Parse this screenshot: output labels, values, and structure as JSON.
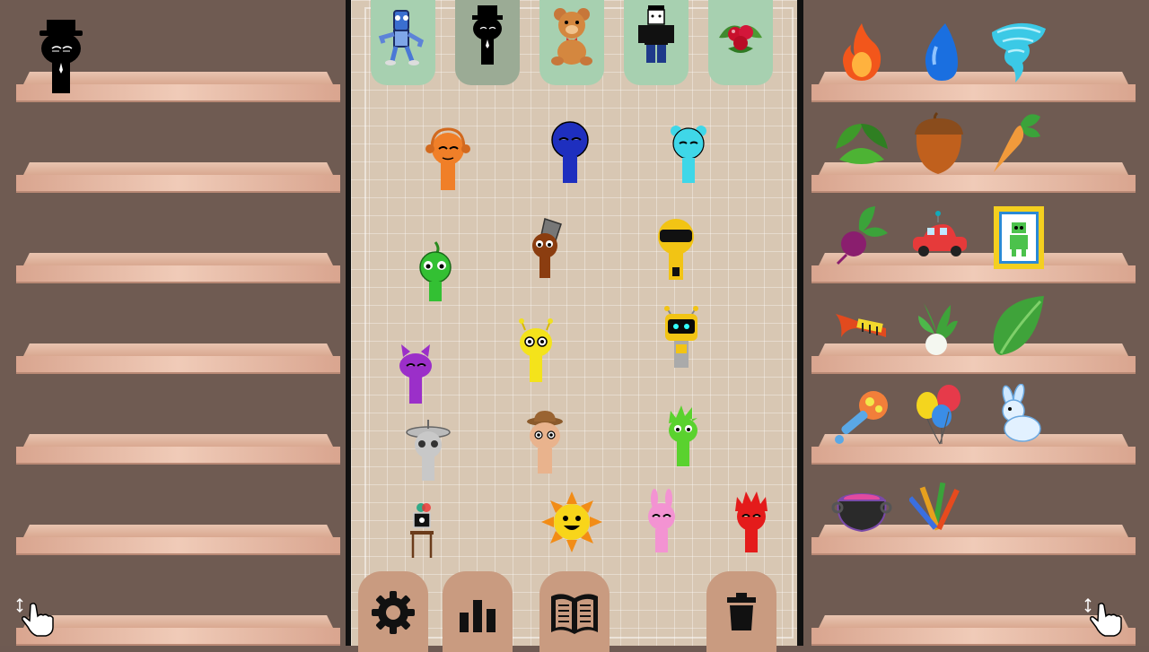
{
  "left_panel": {
    "shelves": 7,
    "placed_items": [
      {
        "id": "black-top-hat",
        "icon": "black-top-hat-character-icon"
      }
    ],
    "scroll_hint": "hand-scroll-icon"
  },
  "top_slots": [
    {
      "icon": "blue-robot-character-icon",
      "state": "available"
    },
    {
      "icon": "black-top-hat-character-icon",
      "state": "used"
    },
    {
      "icon": "teddy-bear-icon",
      "state": "available"
    },
    {
      "icon": "blocky-avatar-icon",
      "state": "available"
    },
    {
      "icon": "berries-icon",
      "state": "available"
    }
  ],
  "stage_characters": [
    "orange-headphones-sprunki",
    "blue-sprunki",
    "cyan-bear-sprunki",
    "green-leaf-sprunki",
    "brown-bucket-sprunki",
    "yellow-visor-sprunki",
    "yellow-antenna-sprunki",
    "robot-sprunki",
    "purple-horned-sprunki",
    "gray-satellite-sprunki",
    "tan-hat-sprunki",
    "lime-spiky-sprunki",
    "tv-head-sprunki",
    "sun-sprunki",
    "pink-bunny-sprunki",
    "red-spiky-sprunki"
  ],
  "toolbar": [
    "settings-gear-icon",
    "stats-bars-icon",
    "open-book-icon",
    "trash-can-icon"
  ],
  "right_panel": {
    "items": [
      "fire-icon",
      "water-drop-icon",
      "tornado-icon",
      "bush-leaves-icon",
      "acorn-icon",
      "carrot-icon",
      "beet-icon",
      "toy-car-icon",
      "robot-picture-icon",
      "trumpet-icon",
      "bok-choy-icon",
      "leaf-icon",
      "rattle-icon",
      "balloons-icon",
      "bunny-icon",
      "cauldron-icon",
      "pencils-icon"
    ],
    "scroll_hint": "hand-scroll-icon"
  },
  "colors": {
    "panel_bg": "#6f5b52",
    "shelf": "#e2b6a1",
    "stage_bg": "#d8c7b3",
    "slot_bg": "#a7d0b0",
    "tool_btn": "#c99b80"
  }
}
